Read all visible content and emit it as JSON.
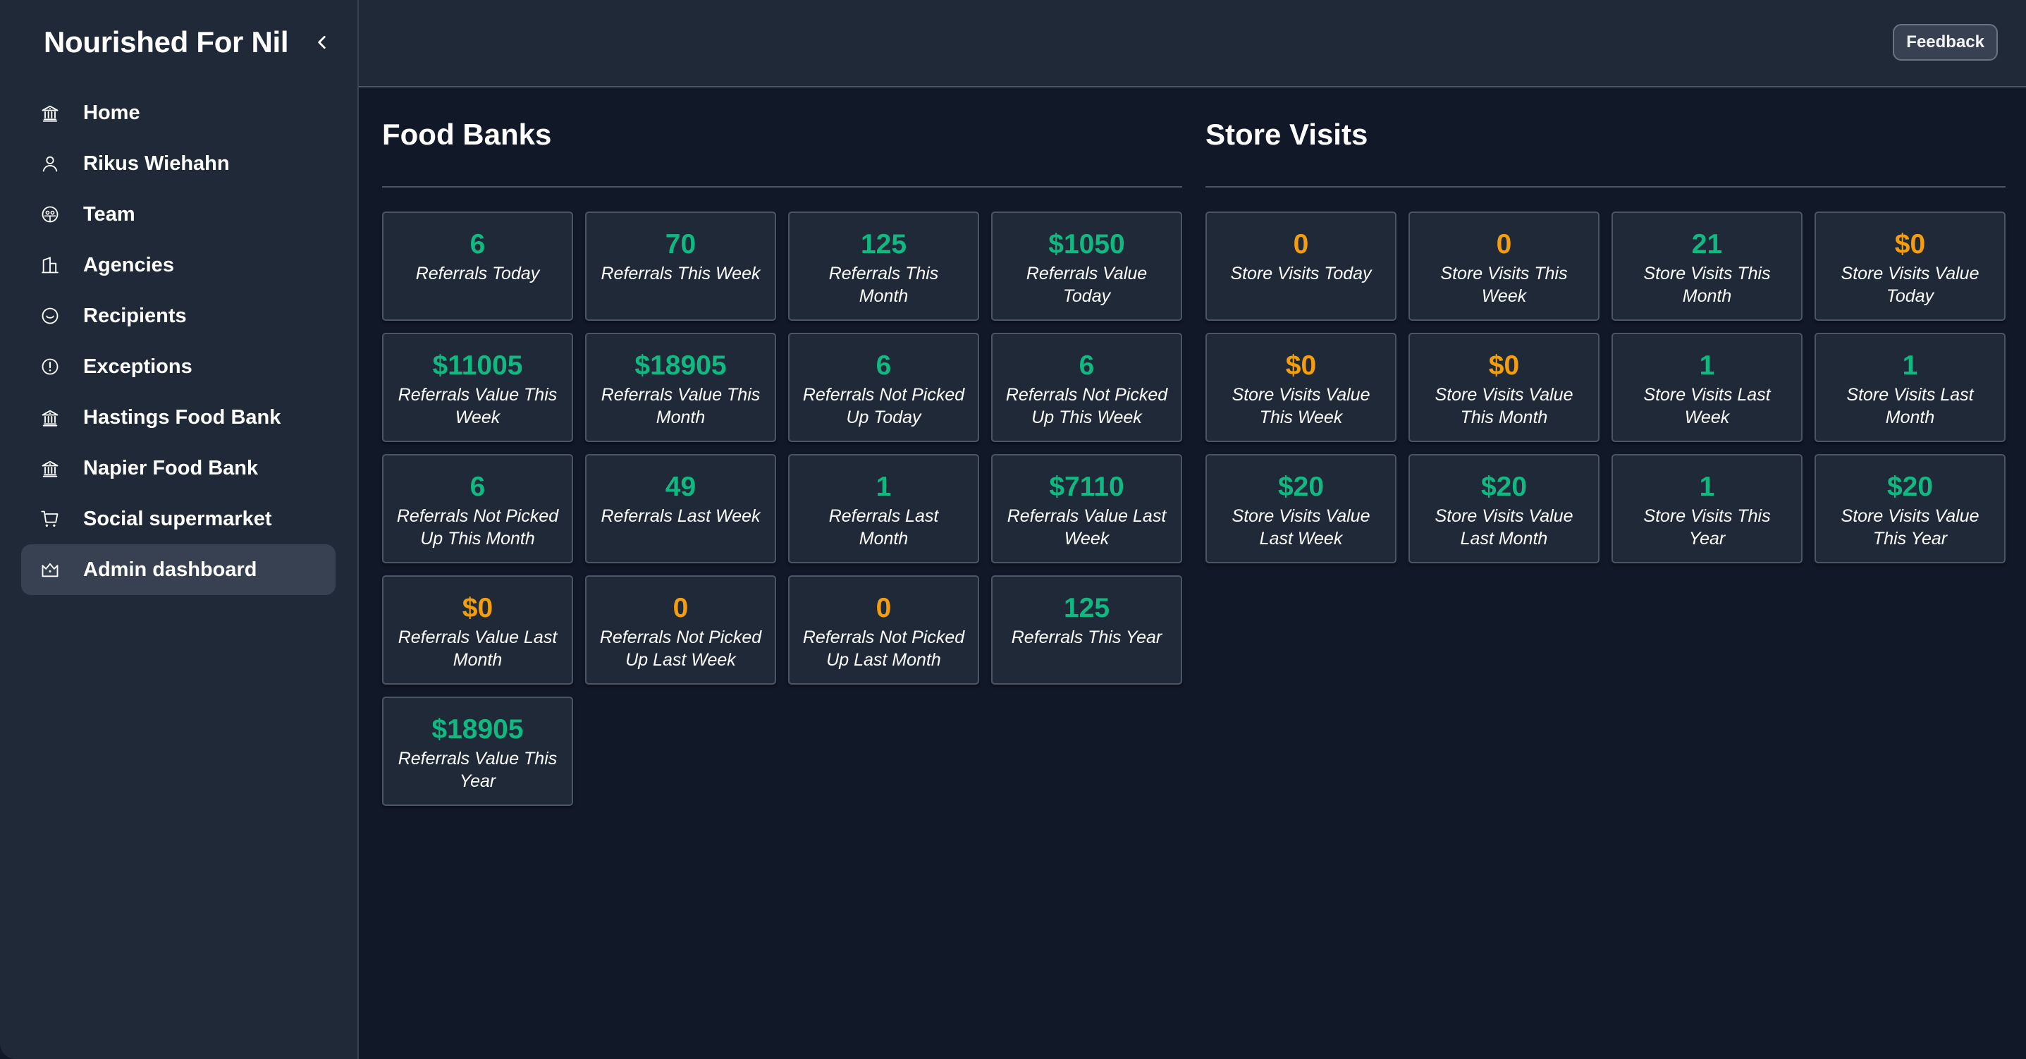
{
  "app": {
    "title": "Nourished For Nil"
  },
  "sidebar": {
    "items": [
      {
        "label": "Home",
        "icon": "bank-icon",
        "active": false
      },
      {
        "label": "Rikus Wiehahn",
        "icon": "user-icon",
        "active": false
      },
      {
        "label": "Team",
        "icon": "team-icon",
        "active": false
      },
      {
        "label": "Agencies",
        "icon": "building-icon",
        "active": false
      },
      {
        "label": "Recipients",
        "icon": "smile-icon",
        "active": false
      },
      {
        "label": "Exceptions",
        "icon": "alert-circle-icon",
        "active": false
      },
      {
        "label": "Hastings Food Bank",
        "icon": "bank-icon",
        "active": false
      },
      {
        "label": "Napier Food Bank",
        "icon": "bank-icon",
        "active": false
      },
      {
        "label": "Social supermarket",
        "icon": "cart-icon",
        "active": false
      },
      {
        "label": "Admin dashboard",
        "icon": "crown-icon",
        "active": true
      }
    ]
  },
  "header": {
    "feedback_label": "Feedback"
  },
  "colors": {
    "positive": "#10b981",
    "zero": "#f59e0b",
    "sidebar_bg": "#1f2937",
    "main_bg": "#111827"
  },
  "food_banks": {
    "title": "Food Banks",
    "cards": [
      {
        "value": "6",
        "label": "Referrals Today",
        "zero": false
      },
      {
        "value": "70",
        "label": "Referrals This Week",
        "zero": false
      },
      {
        "value": "125",
        "label": "Referrals This Month",
        "zero": false
      },
      {
        "value": "$1050",
        "label": "Referrals Value Today",
        "zero": false
      },
      {
        "value": "$11005",
        "label": "Referrals Value This Week",
        "zero": false
      },
      {
        "value": "$18905",
        "label": "Referrals Value This Month",
        "zero": false
      },
      {
        "value": "6",
        "label": "Referrals Not Picked Up Today",
        "zero": false
      },
      {
        "value": "6",
        "label": "Referrals Not Picked Up This Week",
        "zero": false
      },
      {
        "value": "6",
        "label": "Referrals Not Picked Up This Month",
        "zero": false
      },
      {
        "value": "49",
        "label": "Referrals Last Week",
        "zero": false
      },
      {
        "value": "1",
        "label": "Referrals Last Month",
        "zero": false
      },
      {
        "value": "$7110",
        "label": "Referrals Value Last Week",
        "zero": false
      },
      {
        "value": "$0",
        "label": "Referrals Value Last Month",
        "zero": true
      },
      {
        "value": "0",
        "label": "Referrals Not Picked Up Last Week",
        "zero": true
      },
      {
        "value": "0",
        "label": "Referrals Not Picked Up Last Month",
        "zero": true
      },
      {
        "value": "125",
        "label": "Referrals This Year",
        "zero": false
      },
      {
        "value": "$18905",
        "label": "Referrals Value This Year",
        "zero": false
      }
    ]
  },
  "store_visits": {
    "title": "Store Visits",
    "cards": [
      {
        "value": "0",
        "label": "Store Visits Today",
        "zero": true
      },
      {
        "value": "0",
        "label": "Store Visits This Week",
        "zero": true
      },
      {
        "value": "21",
        "label": "Store Visits This Month",
        "zero": false
      },
      {
        "value": "$0",
        "label": "Store Visits Value Today",
        "zero": true
      },
      {
        "value": "$0",
        "label": "Store Visits Value This Week",
        "zero": true
      },
      {
        "value": "$0",
        "label": "Store Visits Value This Month",
        "zero": true
      },
      {
        "value": "1",
        "label": "Store Visits Last Week",
        "zero": false
      },
      {
        "value": "1",
        "label": "Store Visits Last Month",
        "zero": false
      },
      {
        "value": "$20",
        "label": "Store Visits Value Last Week",
        "zero": false
      },
      {
        "value": "$20",
        "label": "Store Visits Value Last Month",
        "zero": false
      },
      {
        "value": "1",
        "label": "Store Visits This Year",
        "zero": false
      },
      {
        "value": "$20",
        "label": "Store Visits Value This Year",
        "zero": false
      }
    ]
  }
}
